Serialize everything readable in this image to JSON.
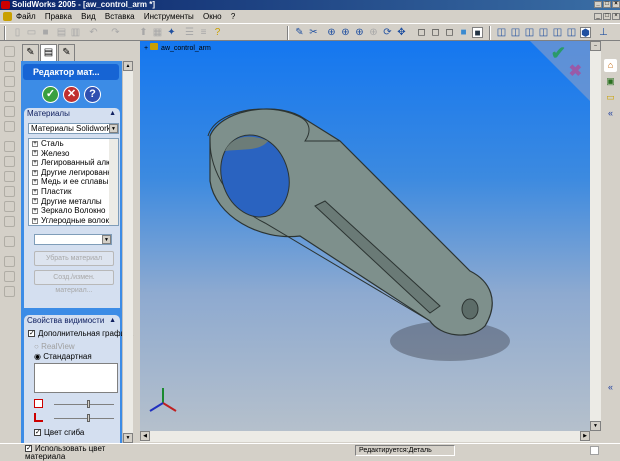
{
  "title": "SolidWorks 2005 - [aw_control_arm *]",
  "menu": [
    "Файл",
    "Правка",
    "Вид",
    "Вставка",
    "Инструменты",
    "Окно",
    "?"
  ],
  "panel": {
    "header": "Редактор мат...",
    "materials_group": {
      "title": "Материалы",
      "library": "Материалы Solidworks",
      "items": [
        "Сталь",
        "Железо",
        "Легированный алюми",
        "Другие легированны",
        "Медь и ее сплавы",
        "Пластик",
        "Другие металлы",
        "Зеркало Волокно",
        "Углеродные волокна"
      ],
      "type_select": "",
      "remove_button": "Убрать материал",
      "edit_button": "Созд./измен. материал..."
    },
    "visibility_group": {
      "title": "Свойства видимости",
      "extra_graphics": "Дополнительная графика",
      "realview": "RealView",
      "standard": "Стандартная",
      "bend_color": "Цвет сгиба",
      "use_material_color": "Использовать цвет материала"
    }
  },
  "viewport": {
    "tree_root": "aw_control_arm"
  },
  "status": {
    "editing": "Редактируется:Деталь"
  }
}
